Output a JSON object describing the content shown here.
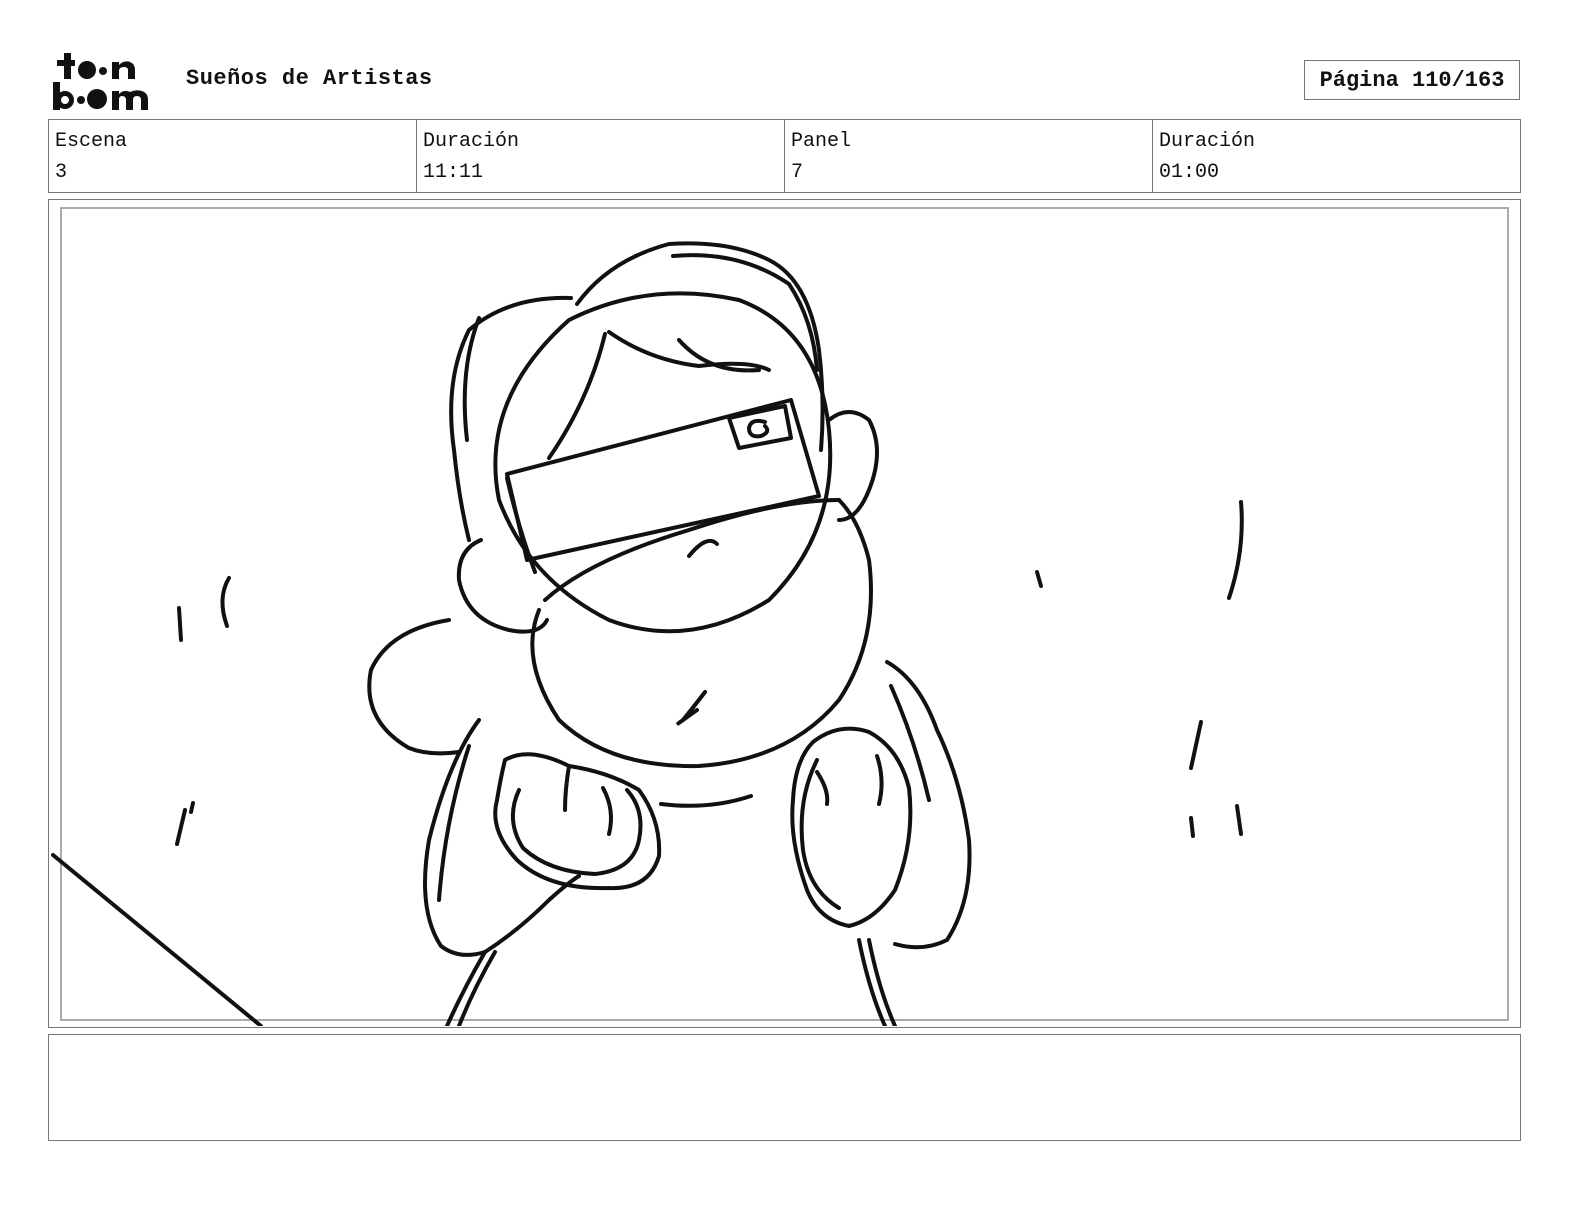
{
  "header": {
    "logo_text": "toonboom",
    "project_title": "Sueños de Artistas",
    "page_indicator": "Página 110/163"
  },
  "info": [
    {
      "label": "Escena",
      "value": "3"
    },
    {
      "label": "Duración",
      "value": "11:11"
    },
    {
      "label": "Panel",
      "value": "7"
    },
    {
      "label": "Duración",
      "value": "01:00"
    }
  ],
  "panel": {
    "sketch_subject": "hand-drawn sketch of a character viewed from above, eyes covered by a headband",
    "headband_glyph": "a"
  },
  "notes": {
    "text": ""
  }
}
